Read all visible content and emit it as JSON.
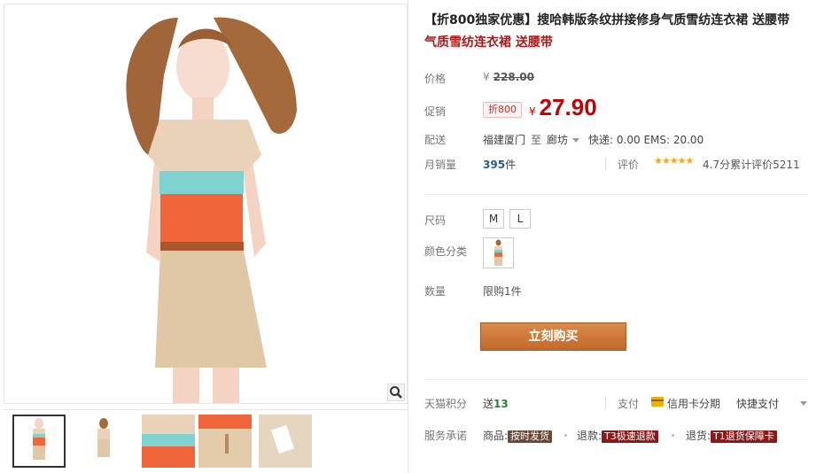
{
  "product": {
    "title_prefix": "【折800独家优惠】",
    "title_main": "搜哈韩版条纹拼接修身气质雪纺连衣裙 送腰带",
    "subtitle": "气质雪纺连衣裙 送腰带"
  },
  "price": {
    "label": "价格",
    "currency": "¥",
    "original": "228.00"
  },
  "promo": {
    "label": "促销",
    "badge": "折800",
    "currency": "¥",
    "price": "27.90"
  },
  "shipping": {
    "label": "配送",
    "from": "福建厦门",
    "to_word": "至",
    "destination": "廊坊",
    "fees": "快递: 0.00 EMS: 20.00"
  },
  "sales": {
    "label": "月销量",
    "count": "395",
    "unit": "件",
    "rating_label": "评价",
    "stars": "★★★★★",
    "score": "4.7分",
    "reviews": "累计评价5211"
  },
  "options": {
    "size_label": "尺码",
    "sizes": [
      "M",
      "L"
    ],
    "color_label": "颜色分类",
    "quantity_label": "数量",
    "quantity_limit": "限购1件"
  },
  "buy_button": "立刻购买",
  "points": {
    "label": "天猫积分",
    "send_word": "送",
    "value": "13"
  },
  "payment": {
    "label": "支付",
    "installment": "信用卡分期",
    "quick": "快捷支付"
  },
  "service": {
    "label": "服务承诺",
    "goods_label": "商品:",
    "goods_tag": "按时发货",
    "refund_label": "退款:",
    "refund_tag": "T3极速退款",
    "return_label": "退货:",
    "return_tag": "T1退货保障卡"
  },
  "colors": {
    "price_red": "#c40000",
    "button_orange": "#c26a2a",
    "stripe_teal": "#7ed3d1",
    "stripe_orange": "#f0653a",
    "beige": "#e9d2b8"
  },
  "icons": {
    "zoom": "magnifier-icon",
    "card": "credit-card-icon"
  }
}
